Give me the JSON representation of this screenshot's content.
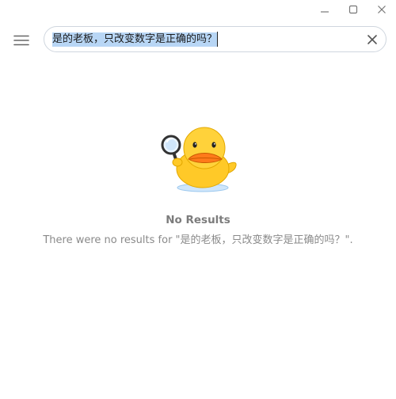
{
  "titlebar": {
    "minimize_icon": "minimize-icon",
    "maximize_icon": "maximize-icon",
    "close_icon": "close-icon"
  },
  "toolbar": {
    "menu_icon": "hamburger-menu-icon",
    "search_value": "是的老板，只改变数字是正确的吗？",
    "clear_icon": "clear-x-icon"
  },
  "empty_state": {
    "title": "No Results",
    "message": "There were no results for \"是的老板，只改变数字是正确的吗？\".",
    "mascot": "duck-magnifier-icon"
  },
  "colors": {
    "selection": "#b8d6f5",
    "search_border": "#cfd6de",
    "muted_text": "#8a8a8a",
    "duck_yellow": "#ffc928",
    "duck_beak": "#ff7a1a"
  }
}
